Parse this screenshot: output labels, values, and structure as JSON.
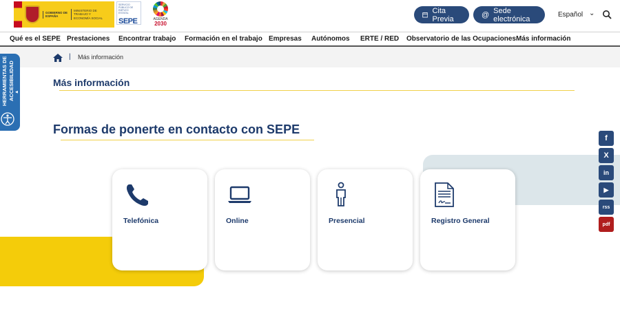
{
  "header": {
    "gov_text_1": "GOBIERNO DE ESPAÑA",
    "gov_text_2": "MINISTERIO DE TRABAJO Y ECONOMÍA SOCIAL",
    "sepe_small": "SERVICIO PÚBLICO DE EMPLEO ESTATAL",
    "sepe_word": "SEPE",
    "agenda_line1": "AGENDA",
    "agenda_line2": "2030",
    "cita_label": "Cita Previa",
    "sede_label": "Sede electrónica",
    "language": "Español"
  },
  "nav": {
    "items": [
      "Qué es el SEPE",
      "Prestaciones",
      "Encontrar trabajo",
      "Formación en el trabajo",
      "Empresas",
      "Autónomos",
      "ERTE / RED",
      "Observatorio de las Ocupaciones",
      "Más información"
    ]
  },
  "breadcrumb": {
    "separator": "|",
    "current": "Más información"
  },
  "accessibility": {
    "label": "HERRAMIENTAS DE ACCESIBILIDAD"
  },
  "main": {
    "section_title": "Más información",
    "heading": "Formas de ponerte en contacto con SEPE",
    "cards": [
      {
        "label": "Telefónica",
        "icon": "phone-icon"
      },
      {
        "label": "Online",
        "icon": "laptop-icon"
      },
      {
        "label": "Presencial",
        "icon": "person-icon"
      },
      {
        "label": "Registro General",
        "icon": "document-icon"
      }
    ]
  },
  "social": [
    "f",
    "X",
    "in",
    "▶",
    "rss",
    "pdf"
  ],
  "colors": {
    "primary": "#1d3a6b",
    "pill": "#2a4a7a",
    "accent_yellow": "#f4cc0a",
    "accent_blue": "#dce6ea",
    "a11y_tab": "#2b6fb3"
  }
}
